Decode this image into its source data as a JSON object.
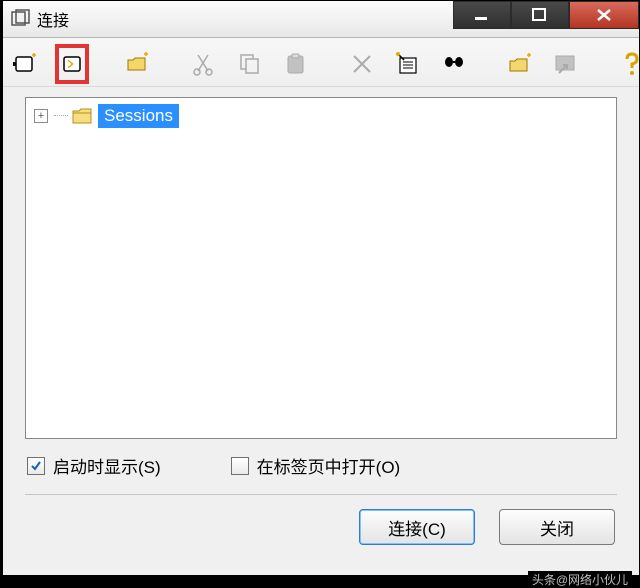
{
  "window": {
    "title": "连接"
  },
  "tree": {
    "root_label": "Sessions",
    "expanded": false
  },
  "checkboxes": {
    "show_on_start": {
      "label": "启动时显示(S)",
      "checked": true
    },
    "open_in_tab": {
      "label": "在标签页中打开(O)",
      "checked": false
    }
  },
  "buttons": {
    "connect": "连接(C)",
    "close": "关闭"
  },
  "watermark": "头条@网络小伙儿"
}
